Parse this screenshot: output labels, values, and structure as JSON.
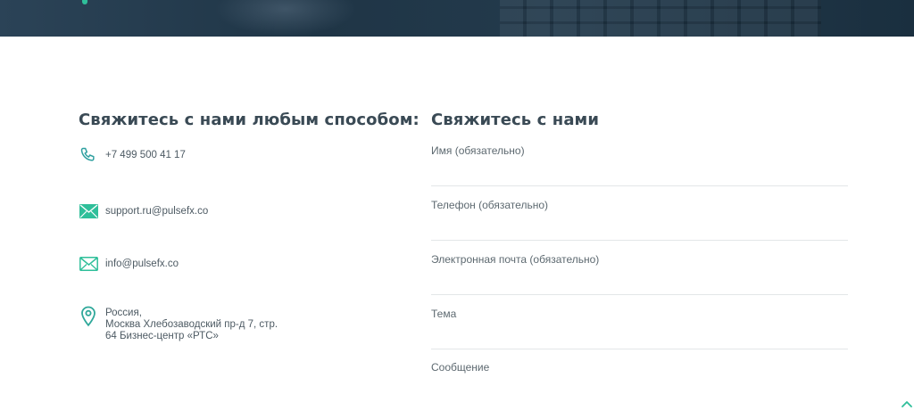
{
  "contacts": {
    "title": "Свяжитесь с нами любым способом:",
    "phone": "+7 499 500 41 17",
    "email_support": "support.ru@pulsefx.co",
    "email_info": "info@pulsefx.co",
    "address": "Россия,\nМосква Хлебозаводский пр-д 7, стр.\n64 Бизнес-центр «РТС»"
  },
  "form": {
    "title": "Свяжитесь с нами",
    "fields": [
      {
        "label": "Имя (обязательно)"
      },
      {
        "label": "Телефон (обязательно)"
      },
      {
        "label": "Электронная почта (обязательно)"
      },
      {
        "label": "Тема"
      },
      {
        "label": "Сообщение"
      }
    ]
  },
  "colors": {
    "accent": "#2fbf9a",
    "heading": "#3a4a55",
    "text": "#4d5a63"
  },
  "icons": {
    "phone": "phone-icon",
    "email_filled": "envelope-filled-icon",
    "email_outline": "envelope-outline-icon",
    "location": "location-pin-icon",
    "scroll_top": "chevron-up-icon"
  }
}
